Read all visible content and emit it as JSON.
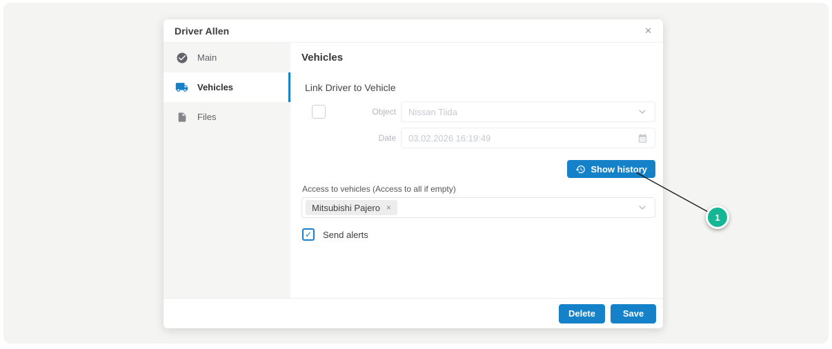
{
  "colors": {
    "accent_blue": "#1581c9",
    "callout_teal": "#14b694",
    "panel_background": "#f4f4f2"
  },
  "modal": {
    "title": "Driver Allen",
    "close_glyph": "✕",
    "sidebar": {
      "items": [
        {
          "label": "Main"
        },
        {
          "label": "Vehicles"
        },
        {
          "label": "Files"
        }
      ]
    },
    "content": {
      "heading": "Vehicles",
      "section_title": "Link Driver to Vehicle",
      "object_row": {
        "label": "Object",
        "value": "Nissan Tiida"
      },
      "date_row": {
        "label": "Date",
        "value": "03.02.2026 16:19:49"
      },
      "show_history_label": "Show history",
      "access_label": "Access to vehicles (Access to all if empty)",
      "access_tags": [
        {
          "label": "Mitsubishi Pajero",
          "remove_glyph": "×"
        }
      ],
      "send_alerts": {
        "label": "Send alerts",
        "checked": true,
        "check_glyph": "✓"
      }
    },
    "footer": {
      "delete_label": "Delete",
      "save_label": "Save"
    }
  },
  "callout": {
    "number": "1"
  }
}
